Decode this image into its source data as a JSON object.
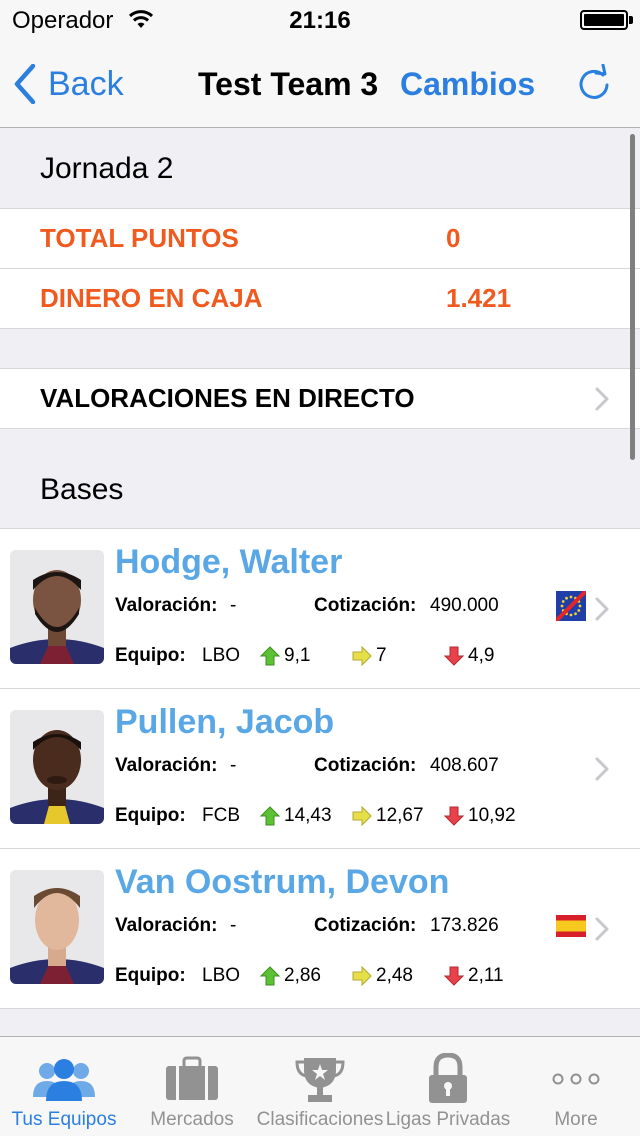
{
  "status_bar": {
    "carrier": "Operador",
    "time": "21:16"
  },
  "nav": {
    "back_label": "Back",
    "title": "Test Team 3",
    "action_label": "Cambios"
  },
  "summary": {
    "header": "Jornada 2",
    "rows": [
      {
        "label": "TOTAL PUNTOS",
        "value": "0"
      },
      {
        "label": "DINERO EN CAJA",
        "value": "1.421"
      }
    ]
  },
  "live": {
    "label": "VALORACIONES EN DIRECTO"
  },
  "section": {
    "title": "Bases"
  },
  "labels": {
    "valoracion": "Valoración:",
    "cotizacion": "Cotización:",
    "equipo": "Equipo:"
  },
  "players": [
    {
      "name": "Hodge, Walter",
      "valoracion": "-",
      "cotizacion": "490.000",
      "equipo": "LBO",
      "up": "9,1",
      "mid": "7",
      "down": "4,9",
      "flag": "eu-flag-icon"
    },
    {
      "name": "Pullen, Jacob",
      "valoracion": "-",
      "cotizacion": "408.607",
      "equipo": "FCB",
      "up": "14,43",
      "mid": "12,67",
      "down": "10,92",
      "flag": ""
    },
    {
      "name": "Van Oostrum, Devon",
      "valoracion": "-",
      "cotizacion": "173.826",
      "equipo": "LBO",
      "up": "2,86",
      "mid": "2,48",
      "down": "2,11",
      "flag": "spain-flag-icon"
    }
  ],
  "tabs": [
    {
      "label": "Tus Equipos",
      "icon": "users-icon",
      "active": true
    },
    {
      "label": "Mercados",
      "icon": "briefcase-icon",
      "active": false
    },
    {
      "label": "Clasificaciones",
      "icon": "trophy-icon",
      "active": false
    },
    {
      "label": "Ligas Privadas",
      "icon": "lock-icon",
      "active": false
    },
    {
      "label": "More",
      "icon": "more-icon",
      "active": false
    }
  ],
  "colors": {
    "accent": "#2b7fe0",
    "highlight": "#f05a1e",
    "player_name": "#5aa7e6",
    "up_arrow": "#5bc236",
    "mid_arrow": "#e8de4a",
    "down_arrow": "#e8434b"
  }
}
